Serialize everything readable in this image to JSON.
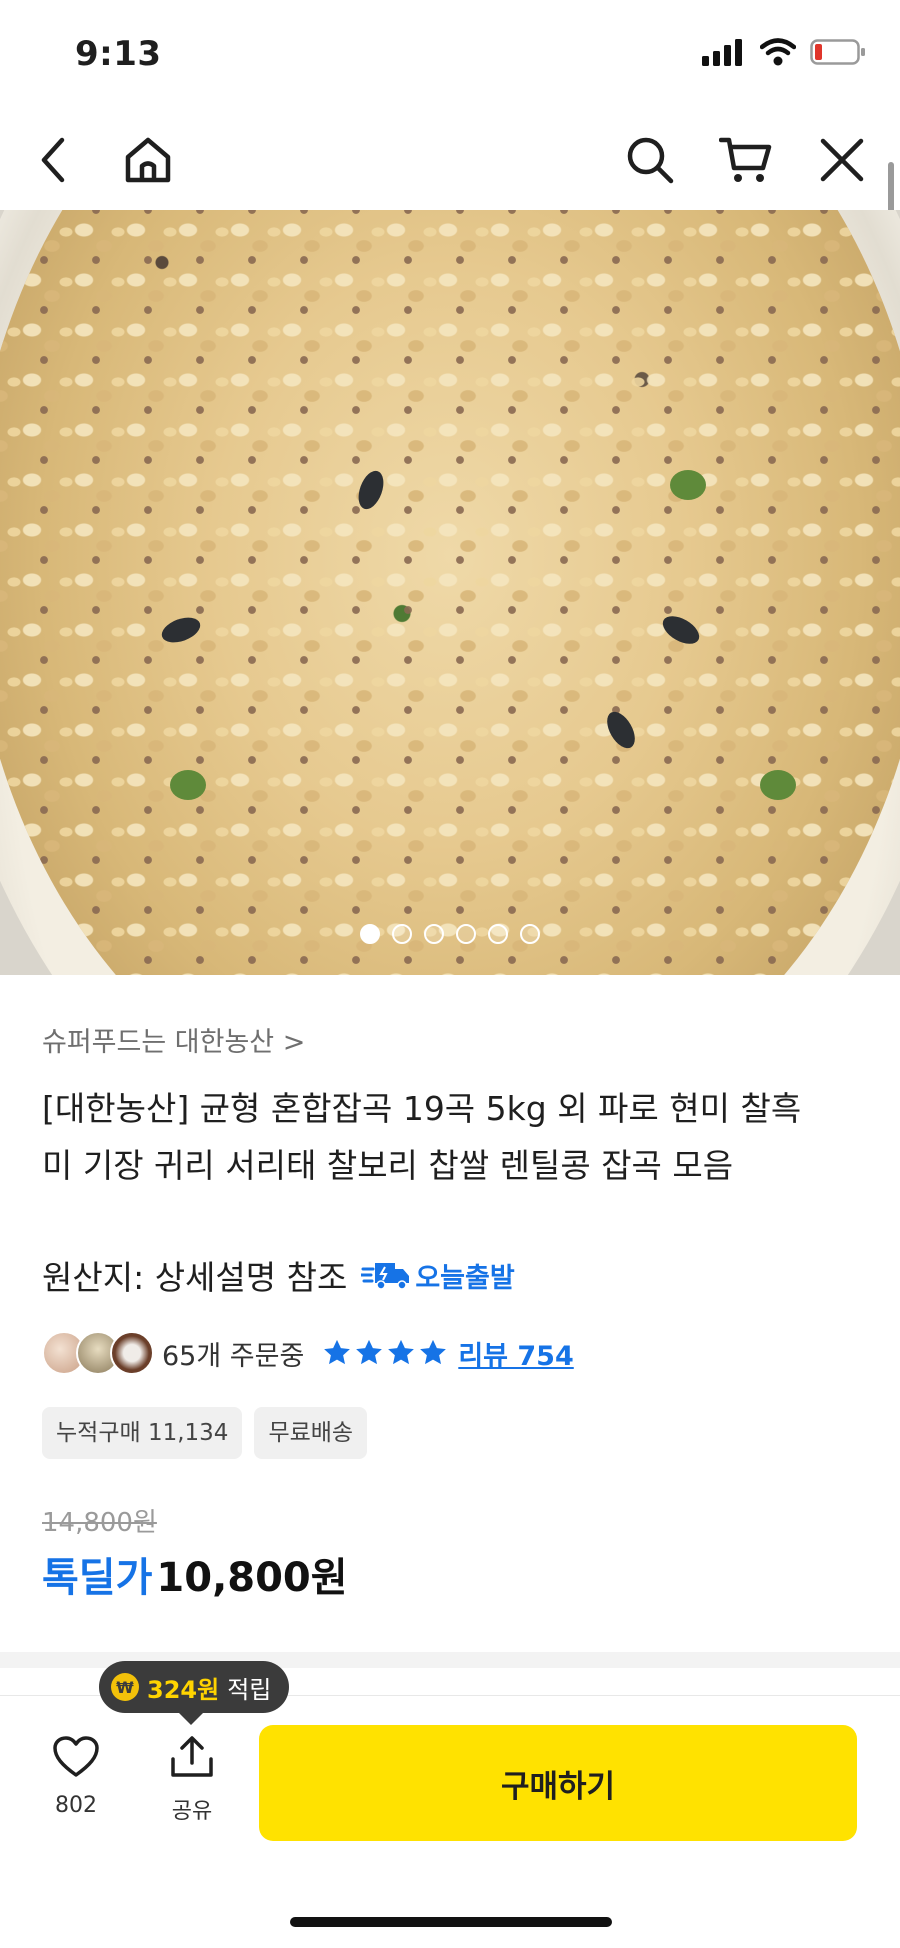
{
  "status_bar": {
    "time": "9:13"
  },
  "nav": {
    "back_icon": "chevron-left-icon",
    "home_icon": "home-icon",
    "search_icon": "search-icon",
    "cart_icon": "cart-icon",
    "close_icon": "close-icon"
  },
  "gallery": {
    "page_count": 6,
    "active_index": 0
  },
  "product": {
    "seller": "슈퍼푸드는 대한농산 >",
    "title": "[대한농산] 균형 혼합잡곡 19곡 5kg 외 파로 현미 찰흑미 기장 귀리 서리태 찰보리 찹쌀 렌틸콩 잡곡 모음",
    "origin": "원산지: 상세설명 참조",
    "shipping_badge": "오늘출발",
    "orders_text": "65개 주문중",
    "rating_stars": 4,
    "review_text": "리뷰 754",
    "tags": [
      "누적구매 11,134",
      "무료배송"
    ],
    "original_price": "14,800원",
    "deal_label": "톡딜가",
    "sale_price": "10,800원"
  },
  "bottom_bar": {
    "points_amount": "324원",
    "points_suffix": "적립",
    "favorite_count": "802",
    "share_label": "공유",
    "buy_label": "구매하기"
  },
  "colors": {
    "accent_blue": "#1673e6",
    "buy_yellow": "#ffe200",
    "tooltip_bg": "#3b3b3b"
  }
}
